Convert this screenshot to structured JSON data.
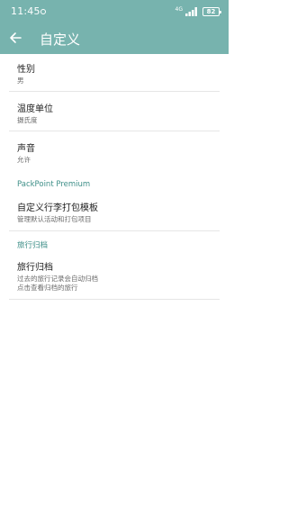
{
  "status_bar": {
    "time": "11:45",
    "network": "4G",
    "battery": "82"
  },
  "app_bar": {
    "title": "自定义"
  },
  "settings": {
    "gender": {
      "title": "性别",
      "value": "男"
    },
    "temperature": {
      "title": "温度单位",
      "value": "摄氏度"
    },
    "sound": {
      "title": "声音",
      "value": "允许"
    }
  },
  "premium_section": {
    "header": "PackPoint Premium",
    "custom_template": {
      "title": "自定义行李打包模板",
      "subtitle": "管理默认活动和打包项目"
    }
  },
  "trip_archive_section": {
    "header": "旅行归档",
    "archive": {
      "title": "旅行归档",
      "subtitle_line1": "过去的旅行记录会自动归档",
      "subtitle_line2": "点击查看归档的旅行"
    }
  },
  "colors": {
    "accent": "#77b3ae",
    "section_header": "#3e8f88"
  }
}
